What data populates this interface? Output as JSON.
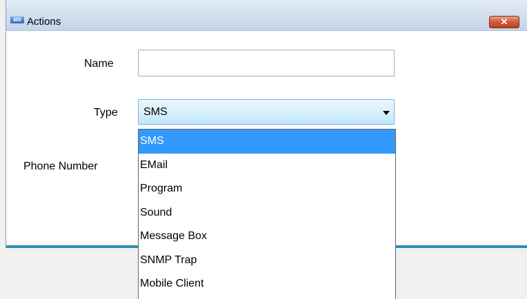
{
  "window": {
    "title": "Actions",
    "app_icon_text": "MX",
    "close_glyph": "✕"
  },
  "form": {
    "name_label": "Name",
    "name_value": "",
    "type_label": "Type",
    "type_value": "SMS",
    "phone_label": "Phone Number"
  },
  "dropdown": {
    "options": [
      "SMS",
      "EMail",
      "Program",
      "Sound",
      "Message Box",
      "SNMP Trap",
      "Mobile Client"
    ],
    "selected_index": 0
  },
  "colors": {
    "selected_bg": "#3399ff",
    "close_button": "#c3401f",
    "window_bottom_border": "#2d8fb0"
  }
}
